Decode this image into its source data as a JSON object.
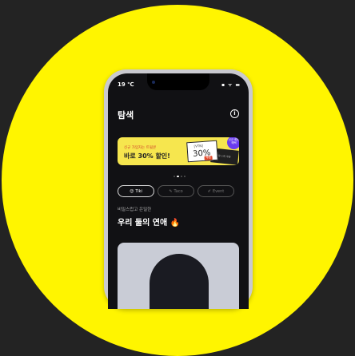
{
  "status": {
    "time": "19 ℃",
    "icons": "▪ ᯤ ▬"
  },
  "header": {
    "title": "탐색"
  },
  "banner": {
    "subtitle": "신규 가입자는 트윗쿤",
    "title": "바로 30% 할인!",
    "ticket_label": "[VTN]",
    "ticket_value": "30%",
    "ticket_stamp": "쿠폰",
    "dark_ticket_text": "무료 1회 쿠폰",
    "badge_text": "신규 회원 혜택"
  },
  "tabs": [
    {
      "label": "Tiki",
      "icon": "😊",
      "active": true
    },
    {
      "label": "Taco",
      "icon": "✎",
      "active": false
    },
    {
      "label": "Event",
      "icon": "✐",
      "active": false
    }
  ],
  "section": {
    "subtitle": "비밀스럽고 은밀한",
    "title": "우리 둘의 연애 🔥"
  },
  "colors": {
    "background": "#232323",
    "accent": "#FFF500",
    "banner": "#F6E64E",
    "badge": "#6A3CF0"
  }
}
